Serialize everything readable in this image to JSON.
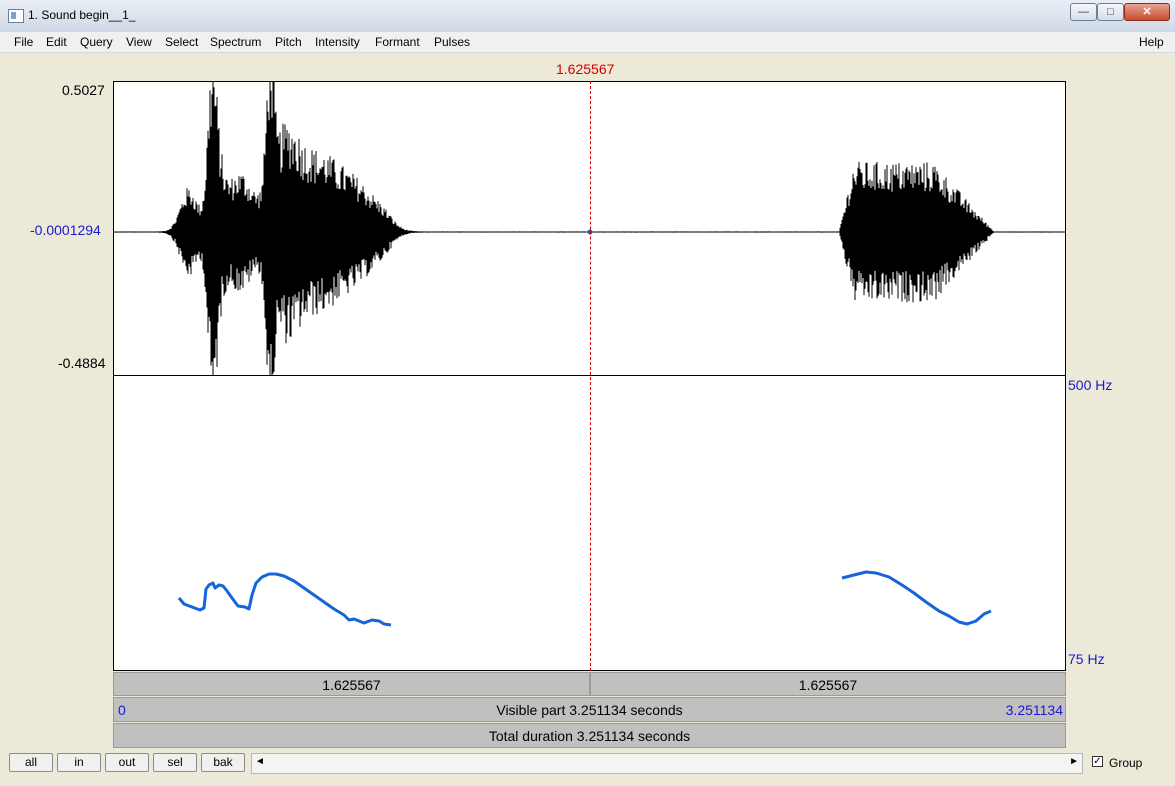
{
  "window": {
    "title": "1. Sound begin__1_",
    "minimize_glyph": "—",
    "maximize_glyph": "□",
    "close_glyph": "✕"
  },
  "menu": {
    "items": [
      "File",
      "Edit",
      "Query",
      "View",
      "Select",
      "Spectrum",
      "Pitch",
      "Intensity",
      "Formant",
      "Pulses"
    ],
    "help": "Help"
  },
  "cursor": {
    "time": "1.625567"
  },
  "waveform": {
    "y_max": "0.5027",
    "y_mid": "-0.0001294",
    "y_min": "-0.4884"
  },
  "pitch": {
    "max_label": "500 Hz",
    "min_label": "75 Hz",
    "color": "#1565d8"
  },
  "selection": {
    "left": "1.625567",
    "right": "1.625567"
  },
  "visible": {
    "start": "0",
    "text": "Visible part 3.251134 seconds",
    "end": "3.251134"
  },
  "total": {
    "text": "Total duration 3.251134 seconds"
  },
  "controls": {
    "buttons": [
      "all",
      "in",
      "out",
      "sel",
      "bak"
    ],
    "scroll_left": "◄",
    "scroll_right": "►",
    "group_label": "Group",
    "group_checked": "✓"
  },
  "colors": {
    "cursor": "#d40000",
    "axis_blue": "#1a1ad0",
    "panel_gray": "#c0c0c0"
  }
}
